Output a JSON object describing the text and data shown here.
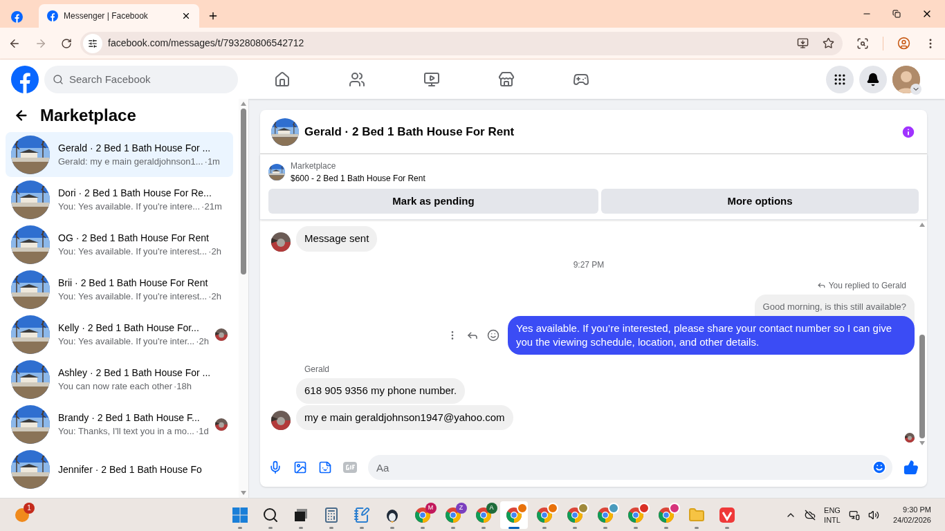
{
  "browser": {
    "tabs": [
      {
        "title": "Messenger | Facebook",
        "selected": true
      }
    ],
    "url": "facebook.com/messages/t/793280806542712"
  },
  "header": {
    "search": {
      "placeholder": "Search Facebook"
    }
  },
  "sidebar": {
    "title": "Marketplace",
    "conversations": [
      {
        "title": "Gerald · 2 Bed 1 Bath House For ...",
        "preview": "Gerald: my e main geraldjohnson1...",
        "time": "·1m",
        "selected": true,
        "seen": false
      },
      {
        "title": "Dori · 2 Bed 1 Bath House For Re...",
        "preview": "You: Yes available. If you're intere...",
        "time": "·21m",
        "selected": false,
        "seen": false
      },
      {
        "title": "OG · 2 Bed 1 Bath House For Rent",
        "preview": "You: Yes available. If you're interest...",
        "time": "·2h",
        "selected": false,
        "seen": false
      },
      {
        "title": "Brii · 2 Bed 1 Bath House For Rent",
        "preview": "You: Yes available. If you're interest...",
        "time": "·2h",
        "selected": false,
        "seen": false
      },
      {
        "title": "Kelly · 2 Bed 1 Bath House For...",
        "preview": "You: Yes available. If you're inter...",
        "time": "·2h",
        "selected": false,
        "seen": true
      },
      {
        "title": "Ashley · 2 Bed 1 Bath House For ...",
        "preview": "You can now rate each other",
        "time": "·18h",
        "selected": false,
        "seen": false
      },
      {
        "title": "Brandy · 2 Bed 1 Bath House F...",
        "preview": "You: Thanks, I'll text you in a mo...",
        "time": "·1d",
        "selected": false,
        "seen": true
      },
      {
        "title": "Jennifer · 2 Bed 1 Bath House Fo",
        "selected": false,
        "seen": false
      }
    ]
  },
  "chat": {
    "title": "Gerald · 2 Bed 1 Bath House For Rent",
    "listing": {
      "source": "Marketplace",
      "name": "$600 - 2 Bed 1 Bath House For Rent"
    },
    "actions": [
      "Mark as pending",
      "More options"
    ],
    "messages": [
      {
        "kind": "incoming",
        "text": "Message sent",
        "avatar": true
      },
      {
        "kind": "timestamp",
        "text": "9:27 PM"
      },
      {
        "kind": "reply_note",
        "text": "You replied to Gerald"
      },
      {
        "kind": "quoted",
        "text": "Good morning, is this still available?"
      },
      {
        "kind": "outgoing",
        "text": "Yes available. If you’re interested, please share your contact number so I can give you the viewing schedule, location, and other details."
      },
      {
        "kind": "sender",
        "text": "Gerald"
      },
      {
        "kind": "incoming",
        "text": "618 905 9356 my phone number.",
        "avatar": false
      },
      {
        "kind": "incoming",
        "text": "my e main geraldjohnson1947@yahoo.com",
        "avatar": true
      }
    ],
    "composer": {
      "placeholder": "Aa"
    }
  },
  "taskbar": {
    "notification_badge": "1",
    "apps": [
      {
        "kind": "windows",
        "selected": false
      },
      {
        "kind": "search",
        "selected": false
      },
      {
        "kind": "taskview",
        "selected": false
      },
      {
        "kind": "calculator",
        "selected": false
      },
      {
        "kind": "notepad",
        "selected": false
      },
      {
        "kind": "penguin",
        "selected": false
      },
      {
        "kind": "chrome",
        "badge": "M",
        "color": "#c2185b",
        "selected": false
      },
      {
        "kind": "chrome",
        "badge": "Z",
        "color": "#7b3fbf",
        "selected": false
      },
      {
        "kind": "chrome",
        "badge": "A",
        "color": "#1e6b3a",
        "selected": false
      },
      {
        "kind": "chrome",
        "color": "#e8710a",
        "selected": true
      },
      {
        "kind": "chrome",
        "color": "#e8710a",
        "selected": false
      },
      {
        "kind": "chrome",
        "color": "#a08a3c",
        "selected": false
      },
      {
        "kind": "chrome",
        "color": "#4a9bbd",
        "selected": false
      },
      {
        "kind": "chrome",
        "color": "#d93025",
        "selected": false
      },
      {
        "kind": "chrome",
        "color": "#d6347c",
        "selected": false
      },
      {
        "kind": "explorer",
        "selected": false
      },
      {
        "kind": "vivaldi",
        "selected": false
      }
    ],
    "language": "ENG",
    "layout": "INTL",
    "time": "9:30 PM",
    "date": "24/02/2026"
  }
}
